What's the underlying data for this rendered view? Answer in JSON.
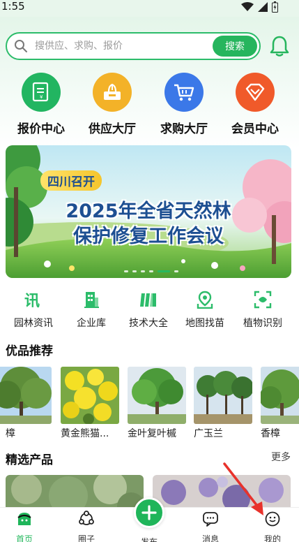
{
  "status": {
    "time": "1:55"
  },
  "search": {
    "placeholder": "搜供应、求购、报价",
    "button_label": "搜索"
  },
  "quick_nav": [
    {
      "label": "报价中心",
      "icon": "quote-icon",
      "color": "#22b561"
    },
    {
      "label": "供应大厅",
      "icon": "supply-icon",
      "color": "#f3b228"
    },
    {
      "label": "求购大厅",
      "icon": "cart-icon",
      "color": "#3b78e8"
    },
    {
      "label": "会员中心",
      "icon": "vip-diamond-icon",
      "color": "#f05a2a"
    }
  ],
  "banner": {
    "tag": "四川召开",
    "line1": "2025年全省天然林",
    "line2": "保护修复工作会议"
  },
  "functions": [
    {
      "label": "园林资讯",
      "icon": "news-icon"
    },
    {
      "label": "企业库",
      "icon": "building-icon"
    },
    {
      "label": "技术大全",
      "icon": "books-icon"
    },
    {
      "label": "地图找苗",
      "icon": "map-pin-icon"
    },
    {
      "label": "植物识别",
      "icon": "scan-leaf-icon"
    }
  ],
  "featured": {
    "title": "优品推荐",
    "items": [
      {
        "name": "樟"
      },
      {
        "name": "黄金熊猫..."
      },
      {
        "name": "金叶复叶槭"
      },
      {
        "name": "广玉兰"
      },
      {
        "name": "香樟"
      }
    ]
  },
  "selected": {
    "title": "精选产品",
    "more_label": "更多"
  },
  "tabs": [
    {
      "label": "首页",
      "icon": "home-icon"
    },
    {
      "label": "圈子",
      "icon": "circle-network-icon"
    },
    {
      "label": "发布",
      "icon": "plus-icon"
    },
    {
      "label": "消息",
      "icon": "message-icon"
    },
    {
      "label": "我的",
      "icon": "profile-face-icon"
    }
  ],
  "colors": {
    "brand": "#26b55d",
    "accent_arrow": "#e8322b"
  }
}
